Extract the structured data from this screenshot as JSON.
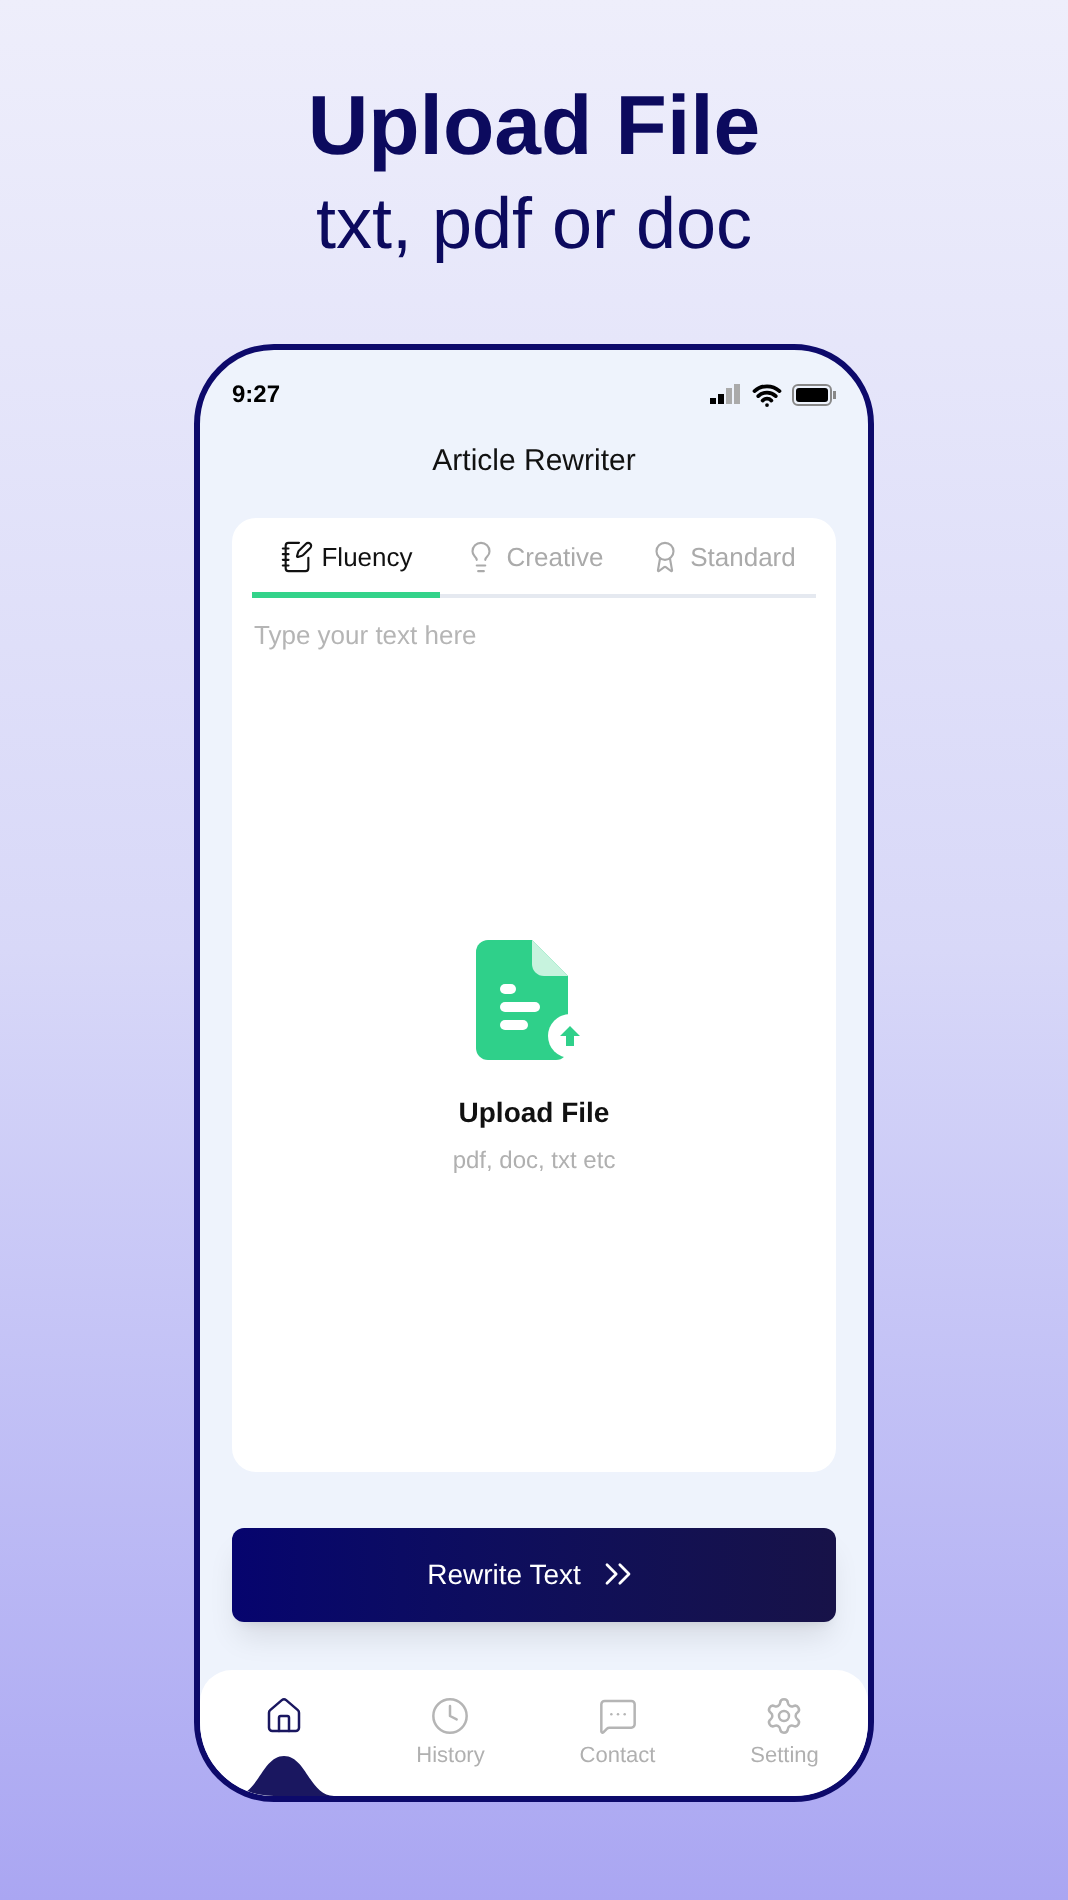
{
  "headline": {
    "title": "Upload File",
    "subtitle": "txt, pdf or doc"
  },
  "status_bar": {
    "time": "9:27"
  },
  "app": {
    "title": "Article Rewriter"
  },
  "tabs": [
    {
      "kind": "fluency",
      "label": "Fluency",
      "selected": true
    },
    {
      "kind": "creative",
      "label": "Creative",
      "selected": false
    },
    {
      "kind": "standard",
      "label": "Standard",
      "selected": false
    }
  ],
  "editor": {
    "placeholder": "Type your text here"
  },
  "upload": {
    "title": "Upload File",
    "hint": "pdf, doc, txt etc"
  },
  "rewrite_button": {
    "label": "Rewrite Text"
  },
  "nav": [
    {
      "kind": "home",
      "selected": true
    },
    {
      "kind": "history",
      "label": "History",
      "selected": false
    },
    {
      "kind": "contact",
      "label": "Contact",
      "selected": false
    },
    {
      "kind": "setting",
      "label": "Setting",
      "selected": false
    }
  ]
}
